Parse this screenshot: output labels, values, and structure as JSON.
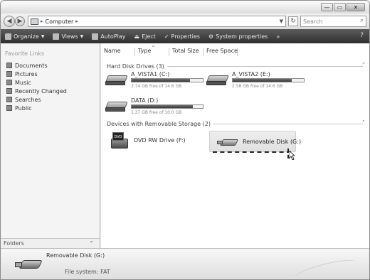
{
  "window": {
    "minimize_glyph": "—",
    "maximize_glyph": "▭",
    "close_glyph": "✕"
  },
  "address_bar": {
    "location": "Computer",
    "separator": "▸",
    "search_placeholder": "Search"
  },
  "toolbar": {
    "items": [
      {
        "label": "Organize",
        "icon": "organize-icon"
      },
      {
        "label": "Views",
        "icon": "views-icon"
      },
      {
        "label": "AutoPlay",
        "icon": "autoplay-icon"
      },
      {
        "label": "Eject",
        "icon": "eject-icon"
      },
      {
        "label": "Properties",
        "icon": "properties-icon"
      },
      {
        "label": "System properties",
        "icon": "system-properties-icon"
      }
    ],
    "overflow_glyph": "»"
  },
  "nav_pane": {
    "title": "Favorite Links",
    "favorites": [
      "Documents",
      "Pictures",
      "Music",
      "Recently Changed",
      "Searches",
      "Public"
    ],
    "folders_label": "Folders"
  },
  "columns": [
    {
      "label": "Name"
    },
    {
      "label": "Type"
    },
    {
      "label": "Total Size"
    },
    {
      "label": "Free Space"
    }
  ],
  "groups": {
    "hard_disk": {
      "label": "Hard Disk Drives (3)",
      "drives": [
        {
          "name": "A_VISTA1 (C:)",
          "free_text": "2.74 GB free of 14.6 GB",
          "used_fraction": 0.82
        },
        {
          "name": "A_VISTA2 (E:)",
          "free_text": "2.58 GB free of 14.6 GB",
          "used_fraction": 0.83
        },
        {
          "name": "DATA (D:)",
          "free_text": "1.37 GB free of 10.0 GB",
          "used_fraction": 0.86
        }
      ]
    },
    "removable": {
      "label": "Devices with Removable Storage (2)",
      "dvd": {
        "name": "DVD RW Drive (F:)",
        "badge": "DVD"
      },
      "usb": {
        "name": "Removable Disk (G:)"
      }
    }
  },
  "details": {
    "title": "Removable Disk (G:)",
    "file_system": "File system: FAT"
  }
}
